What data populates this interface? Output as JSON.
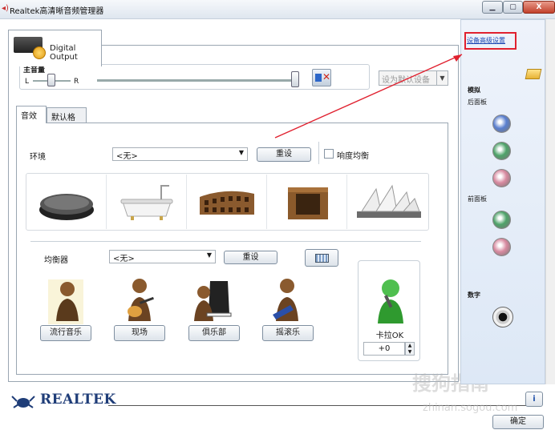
{
  "window": {
    "title": "Realtek高清晰音频管理器",
    "minimize_label": "▁",
    "maximize_label": "▢",
    "close_label": "X"
  },
  "device_tab": {
    "label": "Digital Output"
  },
  "master_volume": {
    "title": "主音量",
    "left_label": "L",
    "right_label": "R",
    "balance": 0.5,
    "level": 1.0,
    "muted": true
  },
  "default_device": {
    "label": "设为默认设备",
    "enabled": false
  },
  "tabs": [
    {
      "label": "音效",
      "active": true
    },
    {
      "label": "默认格式",
      "active": false
    }
  ],
  "environment": {
    "label": "环境",
    "value": "<无>",
    "reset_label": "重设",
    "loudness_label": "响度均衡",
    "loudness_checked": false,
    "presets": [
      "stone-pad",
      "bathtub",
      "colosseum",
      "stone-room",
      "opera-house"
    ]
  },
  "equalizer": {
    "label": "均衡器",
    "value": "<无>",
    "reset_label": "重设",
    "presets": [
      {
        "label": "流行音乐"
      },
      {
        "label": "现场"
      },
      {
        "label": "俱乐部"
      },
      {
        "label": "摇滚乐"
      }
    ]
  },
  "karaoke": {
    "label": "卡拉OK",
    "value": "+0"
  },
  "right_panel": {
    "advanced_settings_label": "设备高级设置",
    "analog_label": "模拟",
    "back_panel_label": "后面板",
    "front_panel_label": "前面板",
    "digital_label": "数字",
    "back_jacks": [
      "#5a7fcf",
      "#4fa36a",
      "#d88aa0"
    ],
    "front_jacks": [
      "#4fa36a",
      "#d88aa0"
    ]
  },
  "footer": {
    "brand": "REALTEK",
    "info_label": "i",
    "ok_label": "确定",
    "watermark": "搜狗指南",
    "watermark_url": "zhinan.sogou.com"
  }
}
